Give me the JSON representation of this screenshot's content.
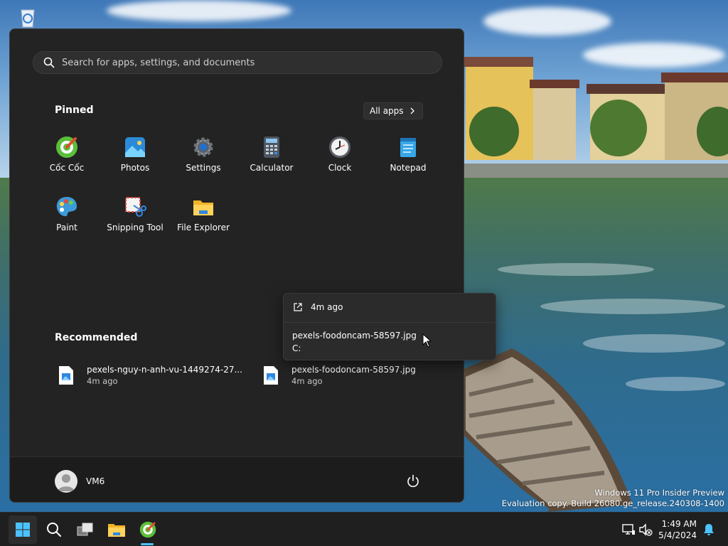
{
  "desktop": {
    "watermark_line1": "Windows 11 Pro Insider Preview",
    "watermark_line2": "Evaluation copy. Build 26080.ge_release.240308-1400"
  },
  "start_menu": {
    "search_placeholder": "Search for apps, settings, and documents",
    "pinned_title": "Pinned",
    "all_apps_label": "All apps",
    "pinned_apps": [
      {
        "label": "Cốc Cốc",
        "icon": "coccoc-browser-icon"
      },
      {
        "label": "Photos",
        "icon": "photos-icon"
      },
      {
        "label": "Settings",
        "icon": "settings-gear-icon"
      },
      {
        "label": "Calculator",
        "icon": "calculator-icon"
      },
      {
        "label": "Clock",
        "icon": "clock-icon"
      },
      {
        "label": "Notepad",
        "icon": "notepad-icon"
      },
      {
        "label": "Paint",
        "icon": "paint-palette-icon"
      },
      {
        "label": "Snipping Tool",
        "icon": "snipping-tool-icon"
      },
      {
        "label": "File Explorer",
        "icon": "folder-icon"
      }
    ],
    "recommended_title": "Recommended",
    "recommended": [
      {
        "name": "pexels-nguy-n-anh-vu-1449274-27...",
        "time": "4m ago"
      },
      {
        "name": "pexels-foodoncam-58597.jpg",
        "time": "4m ago"
      }
    ],
    "user_name": "VM6"
  },
  "popup": {
    "time": "4m ago",
    "file_name": "pexels-foodoncam-58597.jpg",
    "location": "C:"
  },
  "taskbar": {
    "time": "1:49 AM",
    "date": "5/4/2024"
  },
  "colors": {
    "accent": "#4cc2ff",
    "menu_bg": "#232323"
  }
}
